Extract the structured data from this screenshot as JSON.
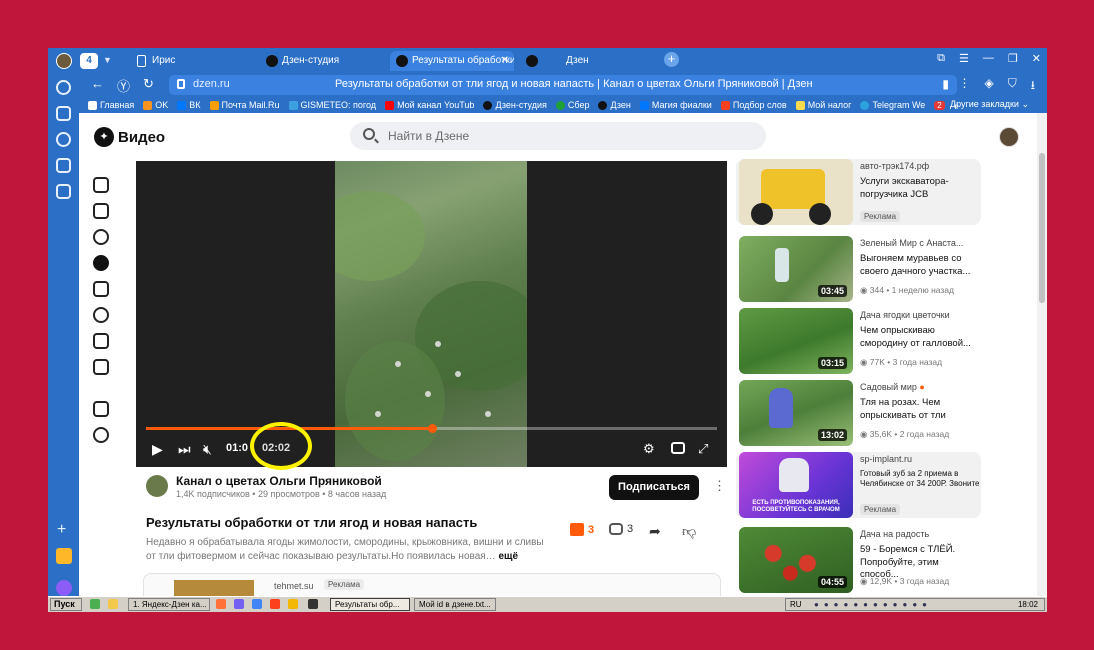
{
  "browser": {
    "tab_counter": "4",
    "tabs": [
      {
        "label": "Ирис"
      },
      {
        "label": "Дзен-студия"
      },
      {
        "label": "Результаты обработки"
      },
      {
        "label": "Дзен"
      }
    ],
    "address_host": "dzen.ru",
    "address_title": "Результаты обработки от тли ягод и новая напасть | Канал о цветах Ольги Пряниковой | Дзен",
    "bookmarks": [
      "Главная",
      "OK",
      "ВК",
      "Почта Mail.Ru",
      "GISMETEO: погод",
      "Мой канал YouTub",
      "Дзен-студия",
      "Сбер",
      "Дзен",
      "Магия фиалки",
      "Подбор слов",
      "Мой налог",
      "Telegram We"
    ],
    "bookmarks_badge": "2",
    "other_bookmarks": "Другие закладки"
  },
  "site": {
    "logo_text": "Видео",
    "search_placeholder": "Найти в Дзене"
  },
  "player": {
    "current_time": "01:0",
    "duration": "02:02",
    "progress": 0.5
  },
  "channel": {
    "name": "Канал о цветах Ольги Пряниковой",
    "meta": "1,4K подписчиков • 29 просмотров • 8 часов назад",
    "subscribe_label": "Подписаться"
  },
  "video": {
    "title": "Результаты обработки от тли ягод и новая напасть",
    "description": "Недавно я обрабатывала ягоды жимолости, смородины, крыжовника, вишни и сливы от тли фитовермом и сейчас показываю результаты.Но появилась новая…",
    "more_label": "ещё",
    "likes": "3",
    "comments": "3"
  },
  "bottom_ad": {
    "source": "tehmet.su",
    "badge": "Реклама"
  },
  "recommendations": [
    {
      "channel": "авто-трэк174.рф",
      "title": "Услуги экскаватора-погрузчика JCB",
      "badge": "Реклама",
      "color": "#f0c22a"
    },
    {
      "channel": "Зеленый Мир с Анаста...",
      "title": "Выгоняем муравьев со своего дачного участка...",
      "meta": "344 • 1 неделю назад",
      "duration": "03:45",
      "color": "#6f9a52"
    },
    {
      "channel": "Дача ягодки цветочки",
      "title": "Чем опрыскиваю смородину от галловой...",
      "meta": "77K • 3 года назад",
      "duration": "03:15",
      "color": "#4f8a3a"
    },
    {
      "channel": "Садовый мир",
      "title": "Тля на розах. Чем опрыскивать от тли",
      "meta": "35,6K • 2 года назад",
      "duration": "13:02",
      "color": "#5d8c48"
    },
    {
      "channel": "sp-implant.ru",
      "title": "Готовый зуб за 2 приема в Челябинске от 34 200Р. Звоните",
      "badge": "Реклама",
      "thumb_text": "ЕСТЬ ПРОТИВОПОКАЗАНИЯ, ПОСОВЕТУЙТЕСЬ С ВРАЧОМ",
      "color": "#7a3cd6"
    },
    {
      "channel": "Дача на радость",
      "title": "59 - Боремся с ТЛЁЙ. Попробуйте, этим способ...",
      "meta": "12,9K • 3 года назад",
      "duration": "04:55",
      "color": "#3f7a2f"
    }
  ],
  "taskbar": {
    "start_label": "Пуск",
    "windows": [
      "1. Яндекс-Дзен ка...",
      "Результаты обр...",
      "Мой id в дзене.txt..."
    ],
    "lang": "RU",
    "clock": "18:02"
  }
}
